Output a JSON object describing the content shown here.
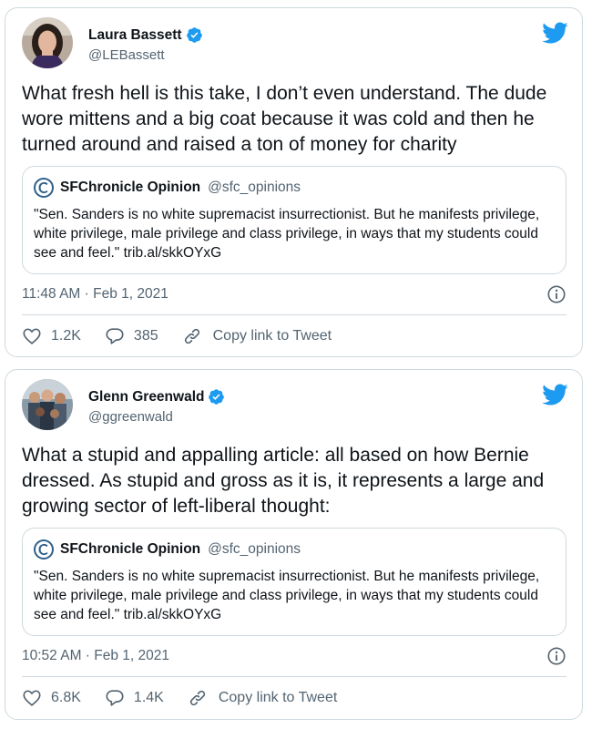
{
  "tweets": [
    {
      "author": {
        "name": "Laura Bassett",
        "handle": "@LEBassett",
        "verified": true
      },
      "text": "What fresh hell is this take, I don’t even understand. The dude wore mittens and a big coat because it was cold and then he turned around and raised a ton of money for charity",
      "quote": {
        "name": "SFChronicle Opinion",
        "handle": "@sfc_opinions",
        "text": "\"Sen. Sanders is no white supremacist insurrectionist. But he manifests privilege, white privilege, male privilege and class privilege, in ways that my students could see and feel.\" trib.al/skkOYxG"
      },
      "timestamp": "11:48 AM · Feb 1, 2021",
      "likes": "1.2K",
      "replies": "385",
      "copy_link_label": "Copy link to Tweet"
    },
    {
      "author": {
        "name": "Glenn Greenwald",
        "handle": "@ggreenwald",
        "verified": true
      },
      "text": "What a stupid and appalling article: all based on how Bernie dressed. As stupid and gross as it is, it represents a large and growing sector of left-liberal thought:",
      "quote": {
        "name": "SFChronicle Opinion",
        "handle": "@sfc_opinions",
        "text": "\"Sen. Sanders is no white supremacist insurrectionist. But he manifests privilege, white privilege, male privilege and class privilege, in ways that my students could see and feel.\" trib.al/skkOYxG"
      },
      "timestamp": "10:52 AM · Feb 1, 2021",
      "likes": "6.8K",
      "replies": "1.4K",
      "copy_link_label": "Copy link to Tweet"
    }
  ],
  "colors": {
    "twitter_blue": "#1d9bf0",
    "muted_text": "#536471",
    "border": "#cfd9de"
  },
  "icons": [
    "verified-badge-icon",
    "twitter-bird-icon",
    "info-icon",
    "heart-icon",
    "reply-icon",
    "link-icon",
    "sfchronicle-logo-icon"
  ]
}
